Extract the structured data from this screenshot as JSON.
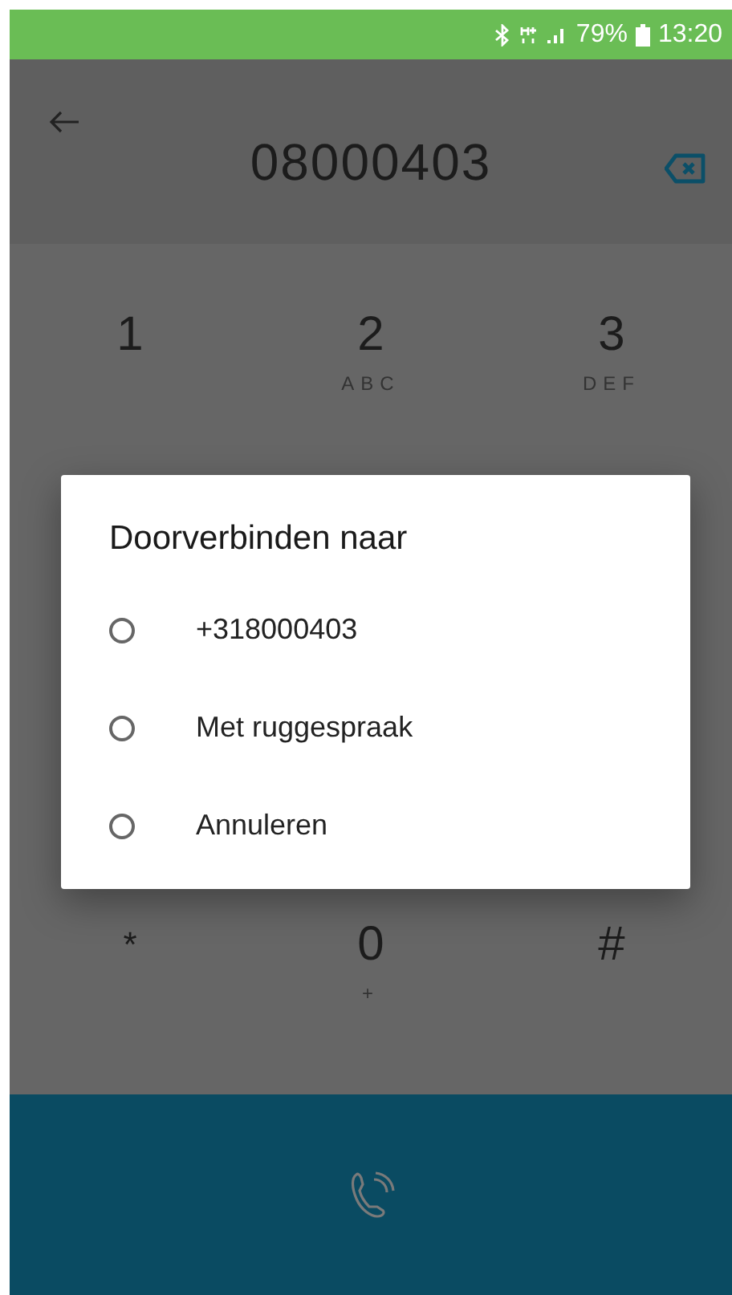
{
  "status_bar": {
    "battery": "79%",
    "time": "13:20"
  },
  "header": {
    "number": "08000403"
  },
  "keypad": [
    {
      "digit": "1"
    },
    {
      "digit": "2",
      "letters": "ABC"
    },
    {
      "digit": "3",
      "letters": "DEF"
    },
    {
      "digit": "*"
    },
    {
      "digit": "0",
      "letters": "+"
    },
    {
      "digit": "#"
    }
  ],
  "dialog": {
    "title": "Doorverbinden naar",
    "options": [
      {
        "label": "+318000403",
        "selected": false
      },
      {
        "label": "Met ruggespraak",
        "selected": false
      },
      {
        "label": "Annuleren",
        "selected": false
      }
    ]
  }
}
